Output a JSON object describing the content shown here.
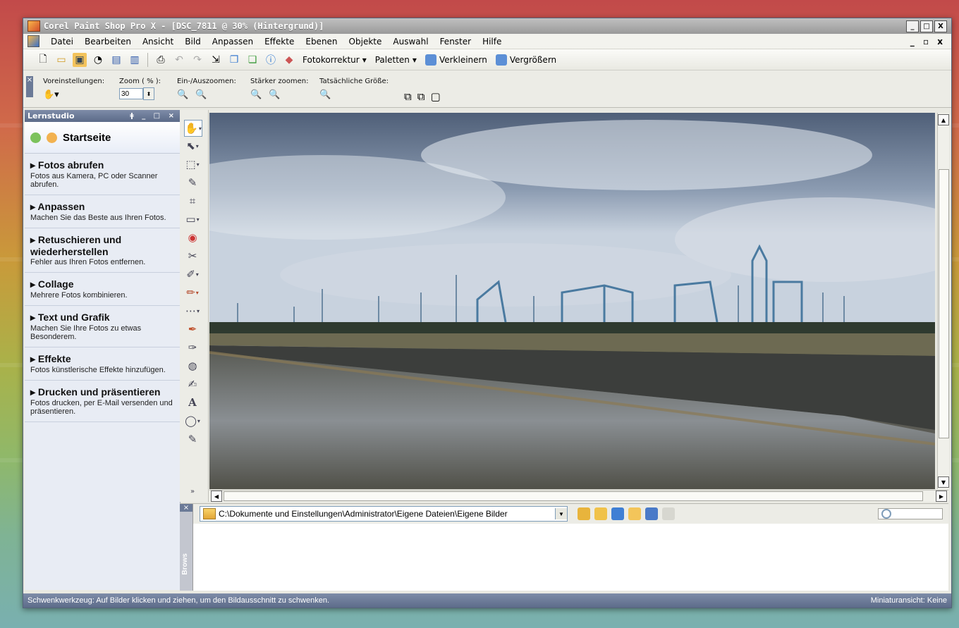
{
  "window": {
    "title": "Corel Paint Shop Pro X - [DSC_7811 @ 30% (Hintergrund)]"
  },
  "menu": [
    "Datei",
    "Bearbeiten",
    "Ansicht",
    "Bild",
    "Anpassen",
    "Effekte",
    "Ebenen",
    "Objekte",
    "Auswahl",
    "Fenster",
    "Hilfe"
  ],
  "toolbar": {
    "fotokorrektur": "Fotokorrektur",
    "paletten": "Paletten",
    "verkleinern": "Verkleinern",
    "vergroessern": "Vergrößern"
  },
  "options": {
    "voreinstellungen": "Voreinstellungen:",
    "zoom_label": "Zoom ( % ):",
    "zoom_value": "30",
    "ein_aus": "Ein-/Auszoomen:",
    "staerker": "Stärker zoomen:",
    "tatsaechlich": "Tatsächliche Größe:"
  },
  "learn": {
    "title": "Lernstudio",
    "home": "Startseite",
    "sections": [
      {
        "title": "Fotos abrufen",
        "desc": "Fotos aus Kamera, PC oder Scanner abrufen."
      },
      {
        "title": "Anpassen",
        "desc": "Machen Sie das Beste aus Ihren Fotos."
      },
      {
        "title": "Retuschieren und wiederherstellen",
        "desc": "Fehler aus Ihren Fotos entfernen."
      },
      {
        "title": "Collage",
        "desc": "Mehrere Fotos kombinieren."
      },
      {
        "title": "Text und Grafik",
        "desc": "Machen Sie Ihre Fotos zu etwas Besonderem."
      },
      {
        "title": "Effekte",
        "desc": "Fotos künstlerische Effekte hinzufügen."
      },
      {
        "title": "Drucken und präsentieren",
        "desc": "Fotos drucken, per E-Mail versenden und präsentieren."
      }
    ]
  },
  "browse": {
    "path": "C:\\Dokumente und Einstellungen\\Administrator\\Eigene Dateien\\Eigene Bilder",
    "tab_label": "Brows"
  },
  "status": {
    "left": "Schwenkwerkzeug: Auf Bilder klicken und ziehen, um den Bildausschnitt zu schwenken.",
    "right": "Miniaturansicht: Keine"
  }
}
